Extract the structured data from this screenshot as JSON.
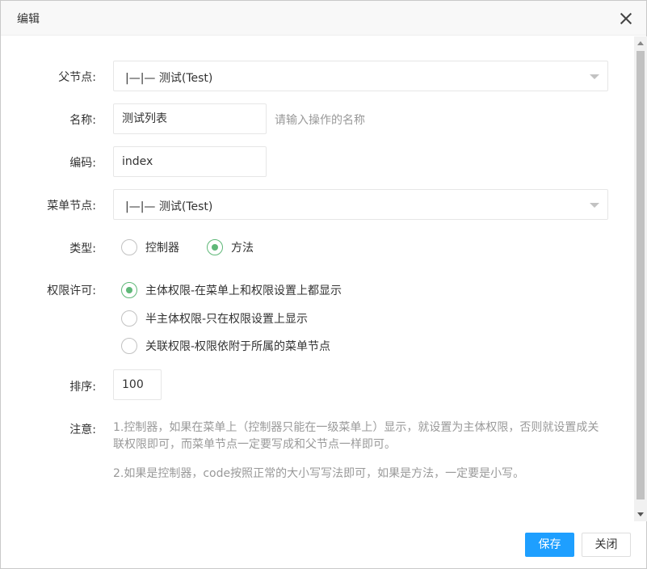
{
  "dialog": {
    "title": "编辑",
    "close_icon": "close-icon"
  },
  "form": {
    "parent_node": {
      "label": "父节点:",
      "value": "|—|— 测试(Test)"
    },
    "name": {
      "label": "名称:",
      "value": "测试列表",
      "hint": "请输入操作的名称"
    },
    "code": {
      "label": "编码:",
      "value": "index"
    },
    "menu_node": {
      "label": "菜单节点:",
      "value": "|—|— 测试(Test)"
    },
    "type": {
      "label": "类型:",
      "options": [
        {
          "label": "控制器",
          "selected": false
        },
        {
          "label": "方法",
          "selected": true
        }
      ]
    },
    "permission": {
      "label": "权限许可:",
      "options": [
        {
          "label": "主体权限-在菜单上和权限设置上都显示",
          "selected": true
        },
        {
          "label": "半主体权限-只在权限设置上显示",
          "selected": false
        },
        {
          "label": "关联权限-权限依附于所属的菜单节点",
          "selected": false
        }
      ]
    },
    "sort": {
      "label": "排序:",
      "value": "100"
    },
    "notice": {
      "label": "注意:",
      "line1": "1.控制器，如果在菜单上（控制器只能在一级菜单上）显示，就设置为主体权限，否则就设置成关联权限即可，而菜单节点一定要写成和父节点一样即可。",
      "line2": "2.如果是控制器，code按照正常的大小写写法即可，如果是方法，一定要是小写。"
    }
  },
  "footer": {
    "save_label": "保存",
    "close_label": "关闭"
  },
  "colors": {
    "primary": "#1e9fff",
    "radio_on": "#5fb878",
    "hint": "#999999"
  }
}
